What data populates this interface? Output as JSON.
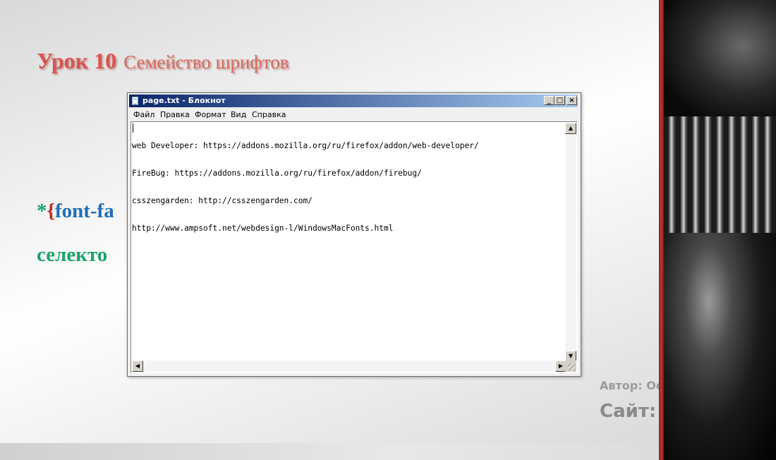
{
  "slide": {
    "title_lesson": "Урок 10",
    "title_subject": "Семейство шрифтов",
    "code_star": "*",
    "code_brace": "{",
    "code_prop": "font-fa",
    "selector_text": "селекто",
    "author_text": "Автор: Османов Мо",
    "site_text": "Сайт: Мо        io.ru"
  },
  "notepad": {
    "title": "page.txt - Блокнот",
    "controls": {
      "minimize": "_",
      "maximize": "□",
      "close": "×"
    },
    "menu": [
      "Файл",
      "Правка",
      "Формат",
      "Вид",
      "Справка"
    ],
    "lines": [
      "web Developer: https://addons.mozilla.org/ru/firefox/addon/web-developer/",
      "FireBug: https://addons.mozilla.org/ru/firefox/addon/firebug/",
      "csszengarden: http://csszengarden.com/",
      "http://www.ampsoft.net/webdesign-l/WindowsMacFonts.html"
    ],
    "scroll_arrows": {
      "up": "▲",
      "down": "▼",
      "left": "◀",
      "right": "▶"
    }
  },
  "colors": {
    "title_red": "#d9534f",
    "code_green": "#1aa36a",
    "code_red": "#cc2222",
    "code_blue": "#1f6fb5",
    "titlebar_start": "#0a246a",
    "titlebar_end": "#a6caf0",
    "accent_bar": "#c43434"
  },
  "icons": {
    "app": "notepad-icon",
    "minimize": "minimize-icon",
    "maximize": "maximize-icon",
    "close": "close-icon"
  }
}
